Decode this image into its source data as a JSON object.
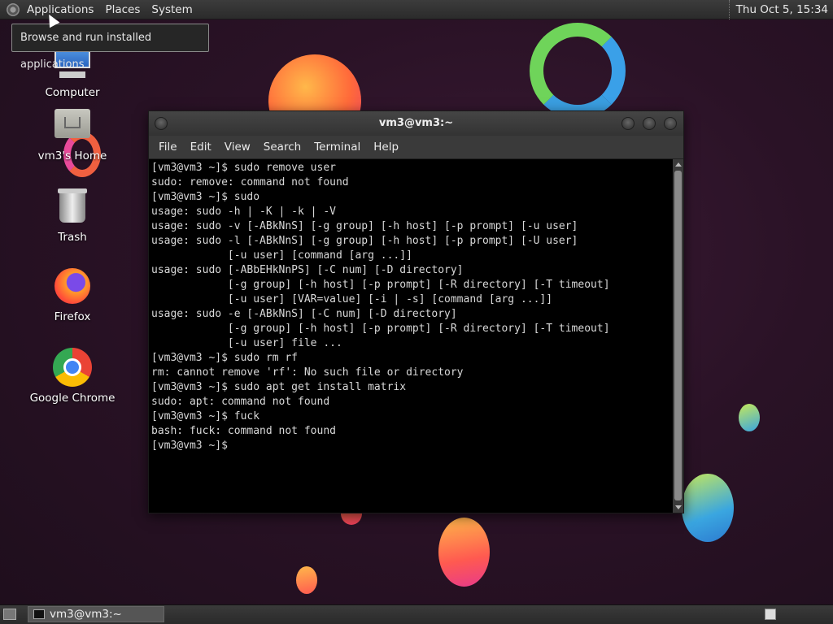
{
  "top_panel": {
    "menus": [
      "Applications",
      "Places",
      "System"
    ],
    "clock": "Thu Oct  5, 15:34"
  },
  "tooltip": "Browse and run installed applications",
  "desktop_icons": [
    "Computer",
    "vm3's Home",
    "Trash",
    "Firefox",
    "Google Chrome"
  ],
  "terminal": {
    "title": "vm3@vm3:~",
    "menu": [
      "File",
      "Edit",
      "View",
      "Search",
      "Terminal",
      "Help"
    ],
    "lines": [
      "[vm3@vm3 ~]$ sudo remove user",
      "sudo: remove: command not found",
      "[vm3@vm3 ~]$ sudo",
      "usage: sudo -h | -K | -k | -V",
      "usage: sudo -v [-ABkNnS] [-g group] [-h host] [-p prompt] [-u user]",
      "usage: sudo -l [-ABkNnS] [-g group] [-h host] [-p prompt] [-U user]",
      "            [-u user] [command [arg ...]]",
      "usage: sudo [-ABbEHkNnPS] [-C num] [-D directory]",
      "            [-g group] [-h host] [-p prompt] [-R directory] [-T timeout]",
      "            [-u user] [VAR=value] [-i | -s] [command [arg ...]]",
      "usage: sudo -e [-ABkNnS] [-C num] [-D directory]",
      "            [-g group] [-h host] [-p prompt] [-R directory] [-T timeout]",
      "            [-u user] file ...",
      "[vm3@vm3 ~]$ sudo rm rf",
      "rm: cannot remove 'rf': No such file or directory",
      "[vm3@vm3 ~]$ sudo apt get install matrix",
      "sudo: apt: command not found",
      "[vm3@vm3 ~]$ fuck",
      "bash: fuck: command not found",
      "[vm3@vm3 ~]$ "
    ]
  },
  "taskbar": {
    "task_label": "vm3@vm3:~"
  }
}
